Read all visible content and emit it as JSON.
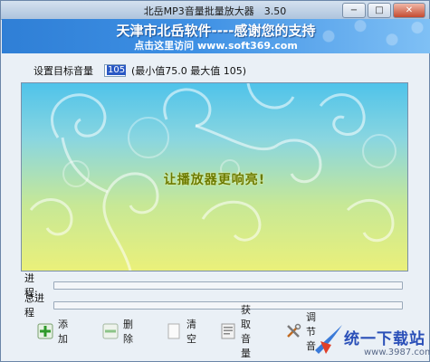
{
  "window": {
    "title": "北岳MP3音量批量放大器　3.50",
    "minimize_glyph": "−",
    "maximize_glyph": "□",
    "close_glyph": "✕"
  },
  "banner": {
    "line1": "天津市北岳软件----感谢您的支持",
    "line2": "点击这里访问 www.soft369.com"
  },
  "target": {
    "label": "设置目标音量",
    "value": "105",
    "range_text": "(最小值75.0  最大值 105)"
  },
  "display": {
    "slogan": "让播放器更响亮!"
  },
  "progress": {
    "current_label": "进　程:",
    "current_value": 0,
    "total_label": "总进程",
    "total_value": 0
  },
  "toolbar": {
    "add_label": "添加",
    "delete_label": "删除",
    "clear_label": "清空",
    "get_volume_label": "获取音量",
    "adjust_label": "调节音"
  },
  "watermark": {
    "text": "统一下载站",
    "url": "www.3987.com"
  },
  "colors": {
    "banner_blue": "#3e90e4",
    "add_green": "#2f9a2a",
    "watermark_blue": "#2a4fb8"
  }
}
